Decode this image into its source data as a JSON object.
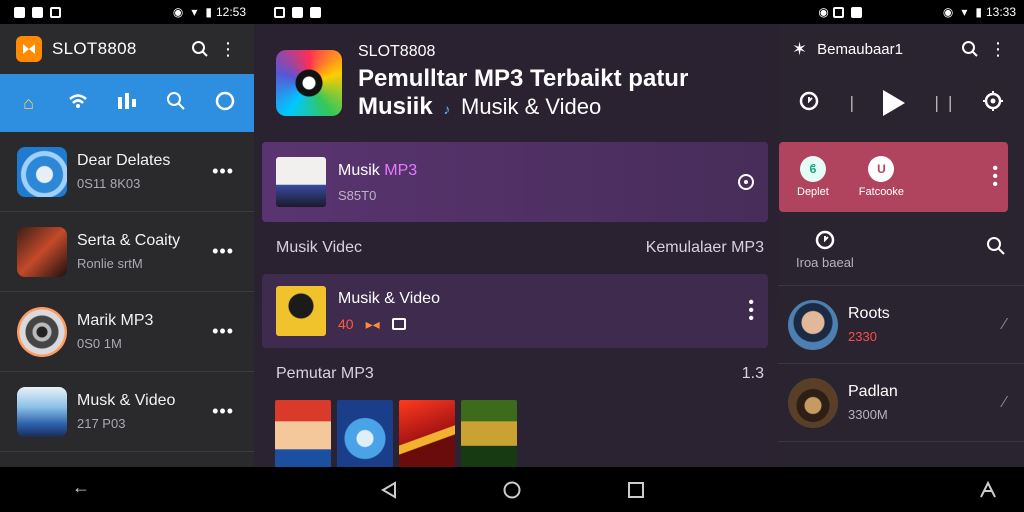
{
  "status_left": {
    "time": "12:53"
  },
  "status_right": {
    "time": "13:33"
  },
  "left": {
    "app_title": "SLOT8808",
    "rows": [
      {
        "title": "Dear Delates",
        "sub": "0S11 8K03"
      },
      {
        "title": "Serta & Coaity",
        "sub": "Ronlie srtM"
      },
      {
        "title": "Marik MP3",
        "sub": "0S0 1M"
      },
      {
        "title": "Musk & Video",
        "sub": "217 P03"
      }
    ]
  },
  "mid": {
    "small_title": "SLOT8808",
    "big_title": "Pemulltar MP3 Terbaikt patur",
    "big_title_line2": "Musiik",
    "big_title_sub": "Musik & Video",
    "card1": {
      "title_a": "Musik ",
      "title_b": "MP3",
      "sub": "S85T0"
    },
    "section1_left": "Musik Videc",
    "section1_right": "Kemulalaer MP3",
    "card2": {
      "title": "Musik & Video",
      "count": "40"
    },
    "section2_left": "Pemutar MP3",
    "section2_right": "1.3"
  },
  "right": {
    "title": "Bemaubaar1",
    "pill1": "Deplet",
    "pill2": "Fatcooke",
    "row2_label": "Iroa baeal",
    "items": [
      {
        "name": "Roots",
        "sub": "2330",
        "sub_color": "#ff4a4a"
      },
      {
        "name": "Padlan",
        "sub": "3300M",
        "sub_color": "#b9b1c3"
      }
    ]
  }
}
